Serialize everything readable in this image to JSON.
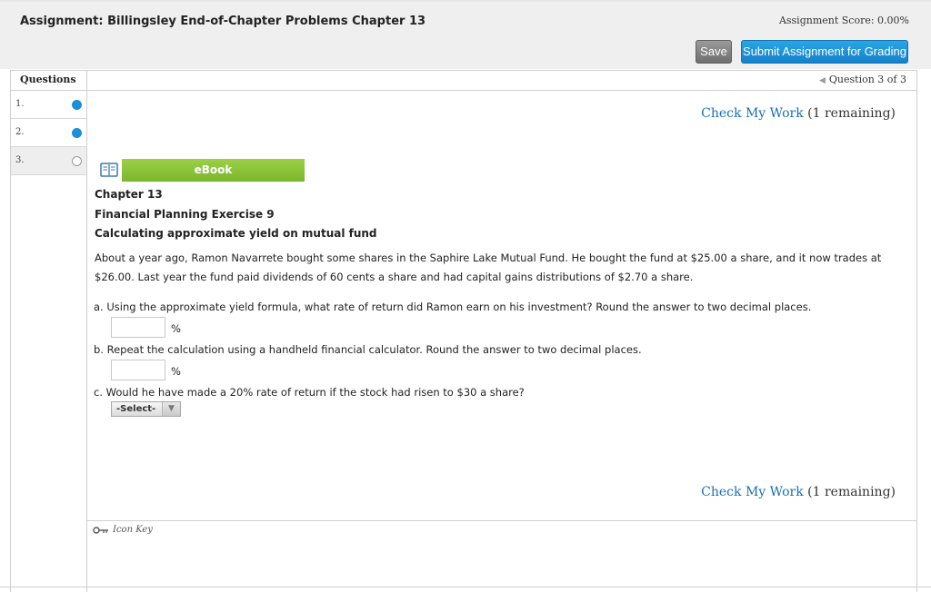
{
  "header": {
    "title": "Assignment: Billingsley End-of-Chapter Problems Chapter 13",
    "score": "Assignment Score: 0.00%",
    "save_label": "Save",
    "submit_label": "Submit Assignment for Grading"
  },
  "sidebar": {
    "heading": "Questions",
    "items": [
      {
        "number": "1.",
        "status": "answered"
      },
      {
        "number": "2.",
        "status": "answered"
      },
      {
        "number": "3.",
        "status": "unanswered"
      }
    ]
  },
  "question_nav": {
    "label": "Question 3 of 3",
    "prev_icon": "triangle-left-icon"
  },
  "check_work": {
    "link": "Check My Work",
    "remaining": "(1 remaining)"
  },
  "ebook": {
    "label": "eBook",
    "icon": "book-icon"
  },
  "problem": {
    "chapter": "Chapter 13",
    "exercise": "Financial Planning Exercise 9",
    "subtitle": "Calculating approximate yield on mutual fund",
    "body": "About a year ago, Ramon Navarrete bought some shares in the Saphire Lake Mutual Fund. He bought the fund at $25.00 a share, and it now trades at $26.00. Last year the fund paid dividends of 60 cents a share and had capital gains distributions of $2.70 a share.",
    "parts": [
      {
        "label": "a. Using the approximate yield formula, what rate of return did Ramon earn on his investment? Round the answer to two decimal places.",
        "value": "",
        "unit": "%"
      },
      {
        "label": "b. Repeat the calculation using a handheld financial calculator. Round the answer to two decimal places.",
        "value": "",
        "unit": "%"
      },
      {
        "label": "c. Would he have made a 20% rate of return if the stock had risen to $30 a share?",
        "select_value": "-Select-"
      }
    ]
  },
  "footer": {
    "icon_key": "Icon Key",
    "icon": "key-icon"
  },
  "colors": {
    "accent_blue": "#1b90d6",
    "ebook_green": "#8bc53f",
    "link_blue": "#1a6fb3"
  }
}
